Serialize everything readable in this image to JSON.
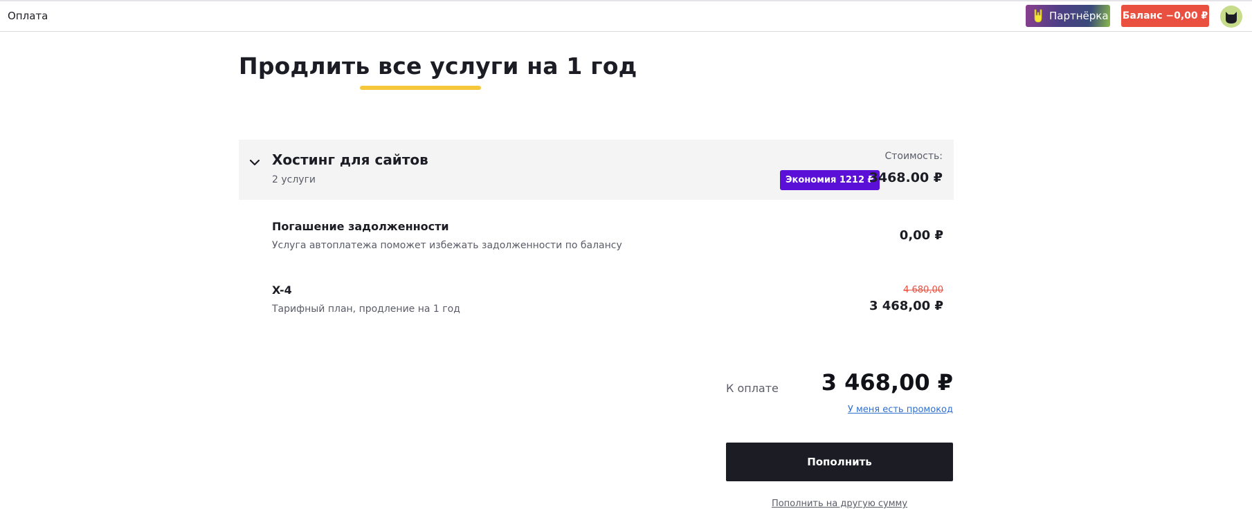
{
  "header": {
    "title": "Оплата",
    "partner_label": "Партнёрка",
    "balance_label": "Баланс −0,00 ₽"
  },
  "page": {
    "title": "Продлить все услуги на 1 год"
  },
  "group": {
    "title": "Хостинг для сайтов",
    "subtitle": "2 услуги",
    "cost_label": "Стоимость:",
    "savings_badge": "Экономия 1212 ₽",
    "price": "3468.00 ₽"
  },
  "items": [
    {
      "name": "Погашение задолженности",
      "description": "Услуга автоплатежа поможет избежать задолженности по балансу",
      "price": "0,00 ₽"
    },
    {
      "name": "X-4",
      "description": "Тарифный план, продление на 1 год",
      "old_price": "4 680,00",
      "price": "3 468,00 ₽"
    }
  ],
  "payment": {
    "label": "К оплате",
    "total": "3 468,00 ₽",
    "promo_link": "У меня есть промокод",
    "topup_button": "Пополнить",
    "other_amount_link": "Пополнить на другую сумму"
  },
  "colors": {
    "accent_yellow": "#f5c73a",
    "balance_red": "#e9503f",
    "savings_purple": "#5a10d6",
    "dark_button": "#1c1d24",
    "link_blue": "#2f6fd0"
  },
  "icons": {
    "partner": "rock-hand-icon",
    "avatar": "cat-avatar-icon",
    "collapse": "chevron-down-icon"
  }
}
